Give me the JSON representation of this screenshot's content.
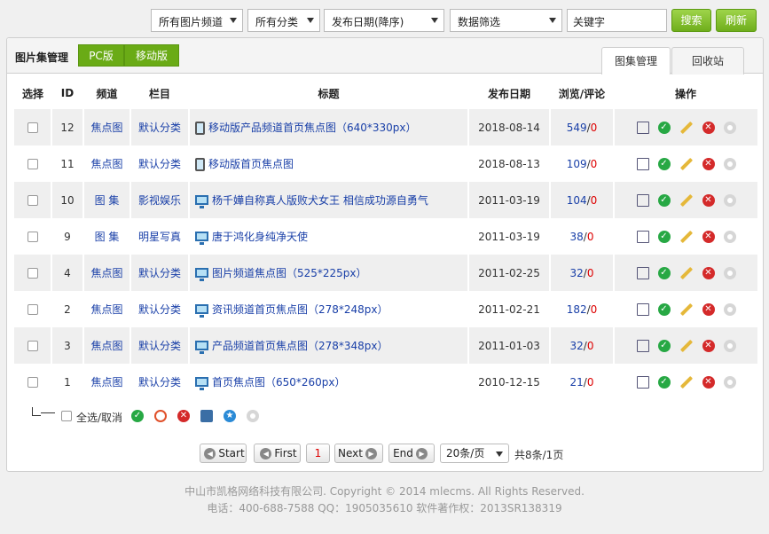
{
  "toolbar": {
    "channel": "所有图片频道",
    "category": "所有分类",
    "sort": "发布日期(降序)",
    "filter": "数据筛选",
    "keyword_placeholder": "关键字",
    "search": "搜索",
    "refresh": "刷新"
  },
  "panel": {
    "title": "图片集管理",
    "view_tabs": [
      "PC版",
      "移动版"
    ],
    "tabs": [
      "图集管理",
      "回收站"
    ]
  },
  "table": {
    "headers": [
      "选择",
      "ID",
      "频道",
      "栏目",
      "标题",
      "发布日期",
      "浏览/评论",
      "操作"
    ],
    "rows": [
      {
        "id": "12",
        "channel": "焦点图",
        "column": "默认分类",
        "device": "phone",
        "title": "移动版产品频道首页焦点图（640*330px）",
        "date": "2018-08-14",
        "views": "549",
        "comments": "0"
      },
      {
        "id": "11",
        "channel": "焦点图",
        "column": "默认分类",
        "device": "phone",
        "title": "移动版首页焦点图",
        "date": "2018-08-13",
        "views": "109",
        "comments": "0"
      },
      {
        "id": "10",
        "channel": "图 集",
        "column": "影视娱乐",
        "device": "pc",
        "title": "杨千嬅自称真人版败犬女王 相信成功源自勇气",
        "date": "2011-03-19",
        "views": "104",
        "comments": "0"
      },
      {
        "id": "9",
        "channel": "图 集",
        "column": "明星写真",
        "device": "pc",
        "title": "唐于鸿化身纯净天使",
        "date": "2011-03-19",
        "views": "38",
        "comments": "0"
      },
      {
        "id": "4",
        "channel": "焦点图",
        "column": "默认分类",
        "device": "pc",
        "title": "图片频道焦点图（525*225px）",
        "date": "2011-02-25",
        "views": "32",
        "comments": "0"
      },
      {
        "id": "2",
        "channel": "焦点图",
        "column": "默认分类",
        "device": "pc",
        "title": "资讯频道首页焦点图（278*248px）",
        "date": "2011-02-21",
        "views": "182",
        "comments": "0"
      },
      {
        "id": "3",
        "channel": "焦点图",
        "column": "默认分类",
        "device": "pc",
        "title": "产品频道首页焦点图（278*348px）",
        "date": "2011-01-03",
        "views": "32",
        "comments": "0"
      },
      {
        "id": "1",
        "channel": "焦点图",
        "column": "默认分类",
        "device": "pc",
        "title": "首页焦点图（650*260px）",
        "date": "2010-12-15",
        "views": "21",
        "comments": "0"
      }
    ]
  },
  "bulk": {
    "select_all": "全选/取消"
  },
  "pager": {
    "start": "Start",
    "first": "First",
    "current": "1",
    "next": "Next",
    "end": "End",
    "per_page": "20条/页",
    "summary": "共8条/1页"
  },
  "footer": {
    "copyright": "中山市凯格网络科技有限公司. Copyright © 2014 mlecms. All Rights Reserved.",
    "contact": "电话：400-688-7588  QQ：1905035610  软件著作权：2013SR138319"
  }
}
